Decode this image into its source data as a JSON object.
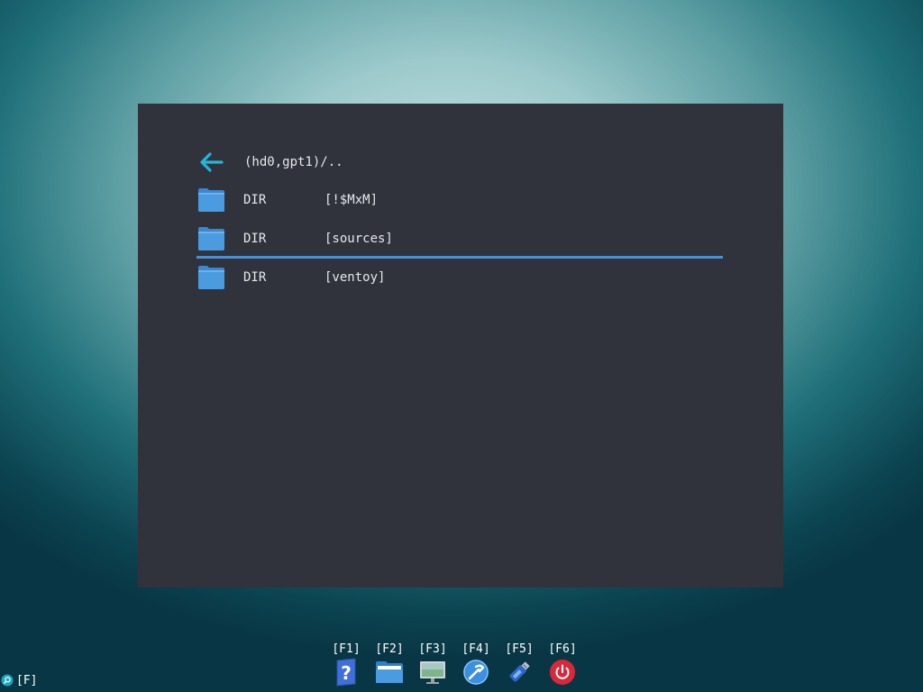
{
  "browser": {
    "parent": {
      "icon": "back-arrow-icon",
      "path": "(hd0,gpt1)/.."
    },
    "entries": [
      {
        "type": "DIR",
        "name": "[!$MxM]",
        "icon": "folder-icon"
      },
      {
        "type": "DIR",
        "name": "[sources]",
        "icon": "folder-icon"
      },
      {
        "type": "DIR",
        "name": "[ventoy]",
        "icon": "folder-icon"
      }
    ],
    "selected_index": 1
  },
  "hotkeys": [
    {
      "key": "[F1]",
      "icon": "help-icon"
    },
    {
      "key": "[F2]",
      "icon": "file-manager-icon"
    },
    {
      "key": "[F3]",
      "icon": "display-icon"
    },
    {
      "key": "[F4]",
      "icon": "tools-icon"
    },
    {
      "key": "[F5]",
      "icon": "usb-drive-icon"
    },
    {
      "key": "[F6]",
      "icon": "power-icon"
    }
  ],
  "search": {
    "icon": "search-icon",
    "label": "[F]"
  },
  "colors": {
    "panel_bg": "#30333c",
    "accent": "#4a8fd6",
    "back_arrow": "#1fb8d8",
    "folder": "#4a9be0",
    "power": "#d8283a"
  }
}
